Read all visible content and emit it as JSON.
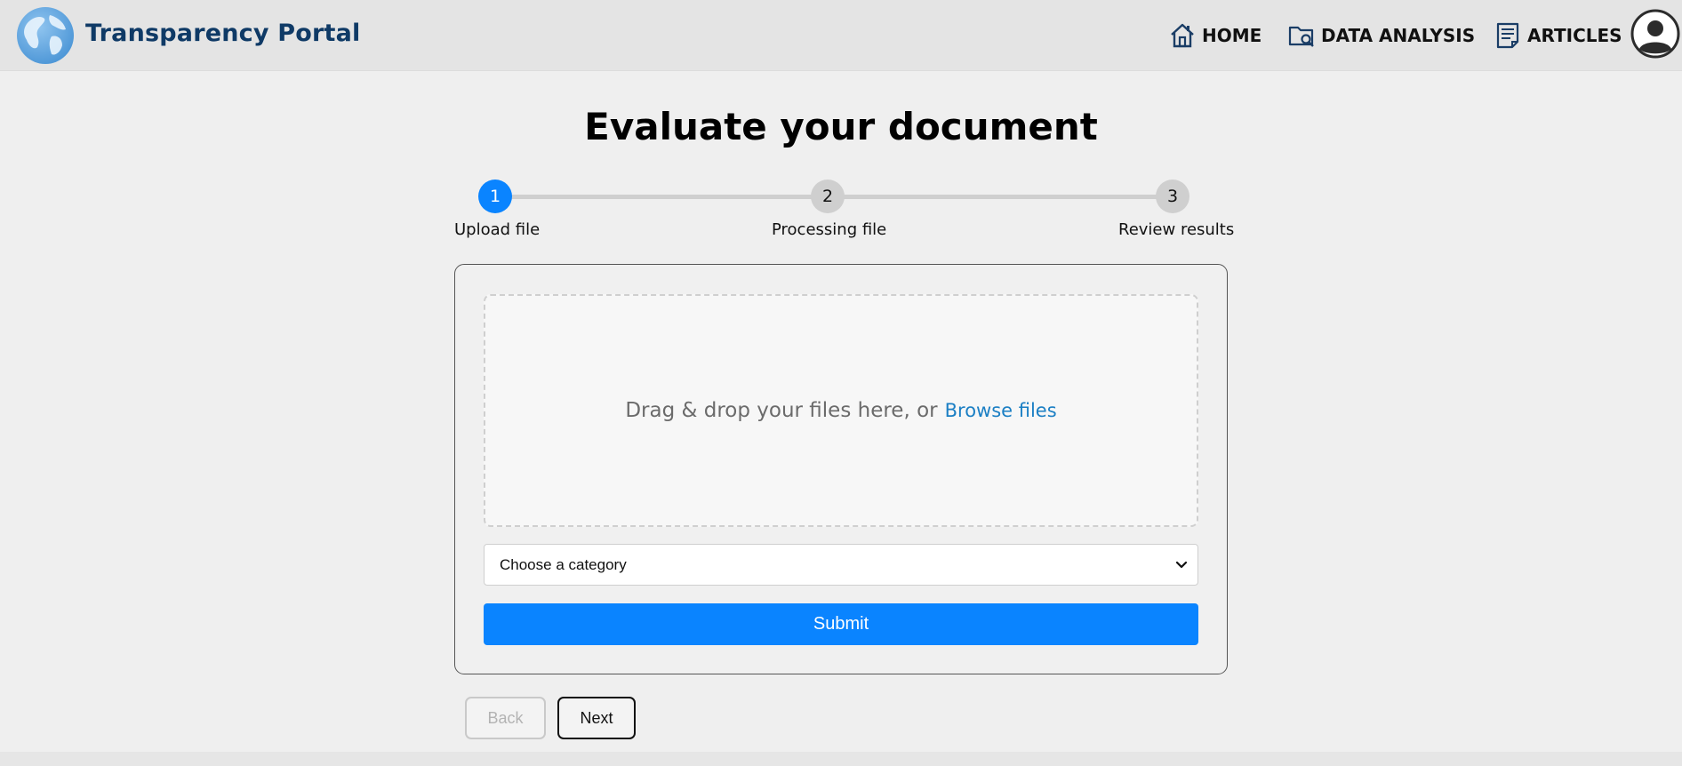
{
  "header": {
    "brand": "Transparency Portal",
    "nav": [
      {
        "label": "HOME",
        "icon": "home-icon"
      },
      {
        "label": "DATA ANALYSIS",
        "icon": "folder-search-icon"
      },
      {
        "label": "ARTICLES",
        "icon": "document-icon"
      }
    ],
    "avatar_icon": "user-avatar-icon",
    "logo_icon": "globe-icon"
  },
  "main": {
    "title": "Evaluate your document",
    "steps": [
      {
        "number": "1",
        "label": "Upload file",
        "state": "active"
      },
      {
        "number": "2",
        "label": "Processing file",
        "state": "inactive"
      },
      {
        "number": "3",
        "label": "Review results",
        "state": "inactive"
      }
    ],
    "dropzone": {
      "text": "Drag & drop your files here, or",
      "link": "Browse files"
    },
    "category_select": {
      "selected": "Choose a category"
    },
    "submit_label": "Submit",
    "back_label": "Back",
    "next_label": "Next"
  },
  "colors": {
    "accent": "#0a84ff",
    "brand": "#0f3a66",
    "link": "#1b7fc4",
    "step_inactive": "#cfcfcf",
    "background": "#efefef",
    "header_bg": "#e4e4e4"
  }
}
